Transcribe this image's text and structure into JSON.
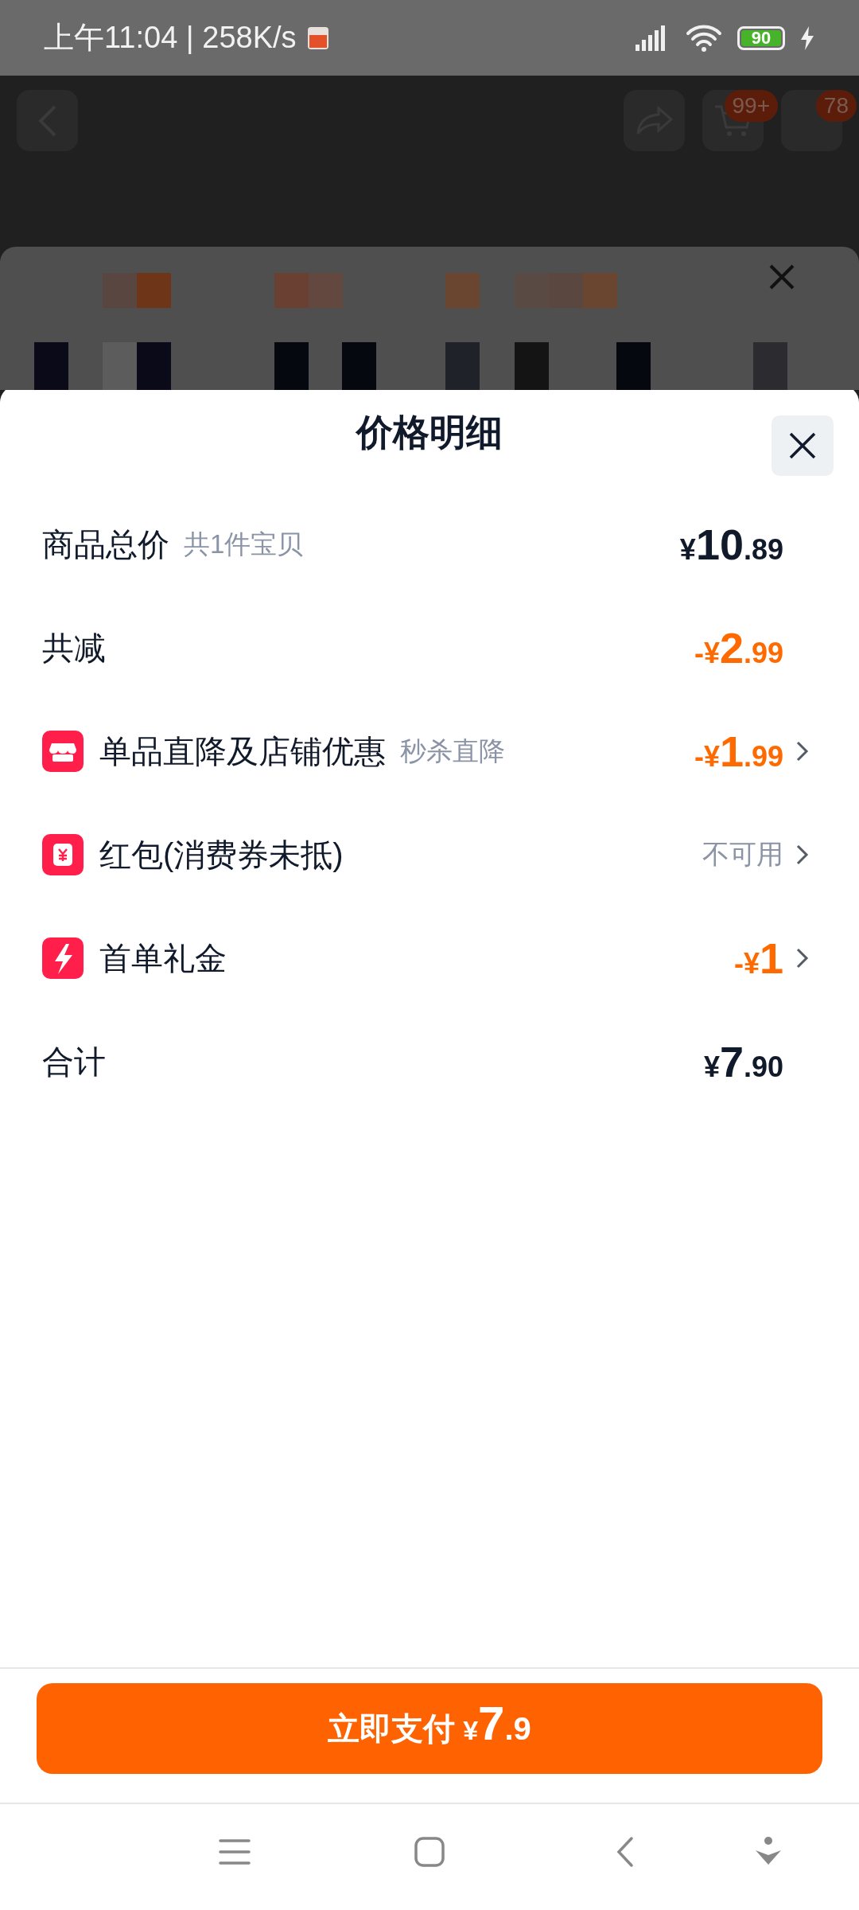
{
  "status_bar": {
    "time_speed": "上午11:04 | 258K/s",
    "battery": "90"
  },
  "background": {
    "badges": [
      "99+",
      "78"
    ]
  },
  "sheet": {
    "title": "价格明细",
    "rows": [
      {
        "kind": "total",
        "label": "商品总价",
        "note": "共1件宝贝",
        "amount": {
          "currency": "¥",
          "whole": "10",
          "fraction": ".89"
        }
      },
      {
        "kind": "saving",
        "label": "共减",
        "amount": {
          "currency": "-¥",
          "whole": "2",
          "fraction": ".99"
        }
      },
      {
        "kind": "store",
        "label": "单品直降及店铺优惠",
        "note": "秒杀直降",
        "amount": {
          "currency": "-¥",
          "whole": "1",
          "fraction": ".99"
        }
      },
      {
        "kind": "coupon",
        "label": "红包(消费券未抵)",
        "value": "不可用"
      },
      {
        "kind": "gift",
        "label": "首单礼金",
        "amount": {
          "currency": "-¥",
          "whole": "1"
        }
      },
      {
        "kind": "sum",
        "label": "合计",
        "amount": {
          "currency": "¥",
          "whole": "7",
          "fraction": ".90"
        }
      }
    ]
  },
  "pay_button": {
    "label": "立即支付",
    "amount": {
      "currency": "¥",
      "whole": "7",
      "fraction": ".9"
    }
  }
}
